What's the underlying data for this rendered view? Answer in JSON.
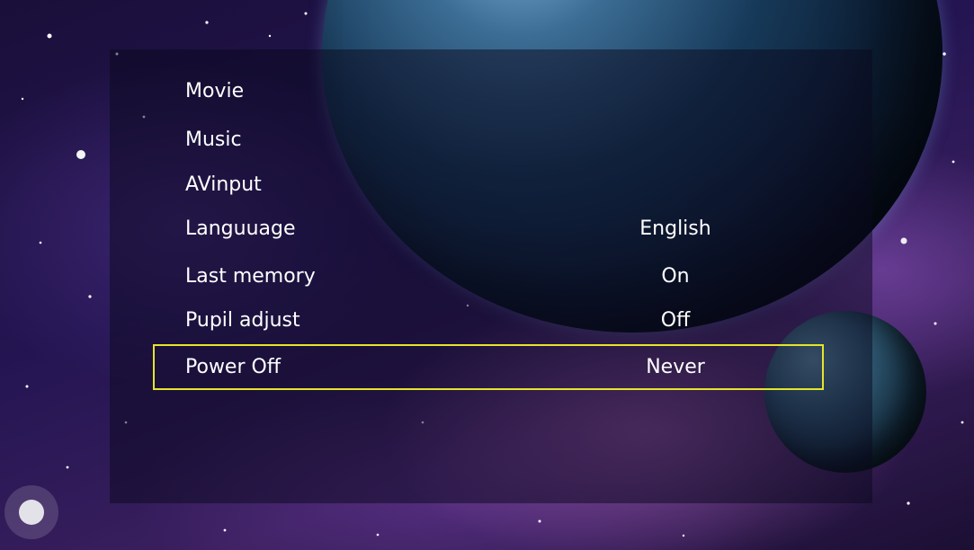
{
  "theme": {
    "highlight_color": "#e5e52a",
    "text_color": "#ffffff"
  },
  "menu": {
    "items": [
      {
        "label": "Movie",
        "value": ""
      },
      {
        "label": "Music",
        "value": ""
      },
      {
        "label": "AVinput",
        "value": ""
      },
      {
        "label": "Languuage",
        "value": "English"
      },
      {
        "label": "Last memory",
        "value": "On"
      },
      {
        "label": "Pupil adjust",
        "value": "Off"
      },
      {
        "label": "Power Off",
        "value": "Never"
      }
    ],
    "selected_index": 6
  }
}
